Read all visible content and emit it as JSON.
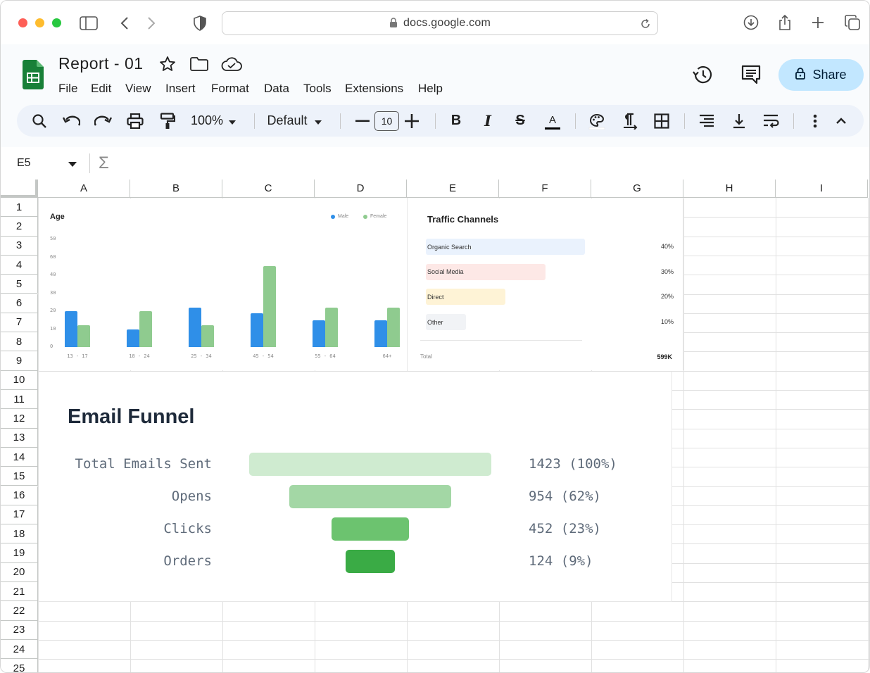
{
  "browser": {
    "url": "docs.google.com"
  },
  "app": {
    "doc_title": "Report - 01",
    "menu": [
      "File",
      "Edit",
      "View",
      "Insert",
      "Format",
      "Data",
      "Tools",
      "Extensions",
      "Help"
    ],
    "share_label": "Share",
    "accent": "#c2e7ff",
    "logo_color": "#188038"
  },
  "toolbar": {
    "zoom": "100%",
    "font": "Default",
    "font_size": "10",
    "bold": "B",
    "italic": "I",
    "strike": "S",
    "text_color": "A"
  },
  "formula_bar": {
    "cell_ref": "E5",
    "sigma": "Σ"
  },
  "columns": [
    "A",
    "B",
    "C",
    "D",
    "E",
    "F",
    "G",
    "H",
    "I"
  ],
  "rows": [
    "1",
    "2",
    "3",
    "4",
    "5",
    "6",
    "7",
    "8",
    "9",
    "10",
    "11",
    "12",
    "13",
    "14",
    "15",
    "16",
    "17",
    "18",
    "19",
    "20",
    "21",
    "22",
    "23",
    "24",
    "25"
  ],
  "chart_data": [
    {
      "type": "bar",
      "title": "Age",
      "categories": [
        "13 - 17",
        "18 - 24",
        "25 - 34",
        "45 - 54",
        "55 - 64",
        "64+"
      ],
      "series": [
        {
          "name": "Male",
          "color": "#2f8fe8",
          "values": [
            20,
            10,
            22,
            19,
            15,
            15
          ]
        },
        {
          "name": "Female",
          "color": "#8fcb8f",
          "values": [
            12,
            20,
            12,
            45,
            22,
            22
          ]
        }
      ],
      "y_ticks": [
        "0",
        "10",
        "20",
        "30",
        "40",
        "60",
        "50"
      ],
      "ylim": [
        0,
        60
      ],
      "legend": "top-right"
    },
    {
      "type": "bar",
      "title": "Traffic Channels",
      "orientation": "horizontal",
      "categories": [
        "Organic Search",
        "Social Media",
        "Direct",
        "Other"
      ],
      "values": [
        40,
        30,
        20,
        10
      ],
      "labels": [
        "40%",
        "30%",
        "20%",
        "10%"
      ],
      "colors": [
        "#eaf2fd",
        "#fde8e6",
        "#fef3d6",
        "#f1f3f6"
      ],
      "total_label": "Total",
      "total_value": "599K"
    },
    {
      "type": "bar",
      "title": "Email Funnel",
      "orientation": "funnel",
      "categories": [
        "Total Emails Sent",
        "Opens",
        "Clicks",
        "Orders"
      ],
      "values": [
        1423,
        954,
        452,
        124
      ],
      "labels": [
        "1423 (100%)",
        "954 (62%)",
        "452 (23%)",
        "124 (9%)"
      ],
      "colors": [
        "#cfebd0",
        "#a3d7a5",
        "#6cc36f",
        "#3aab45"
      ]
    }
  ]
}
